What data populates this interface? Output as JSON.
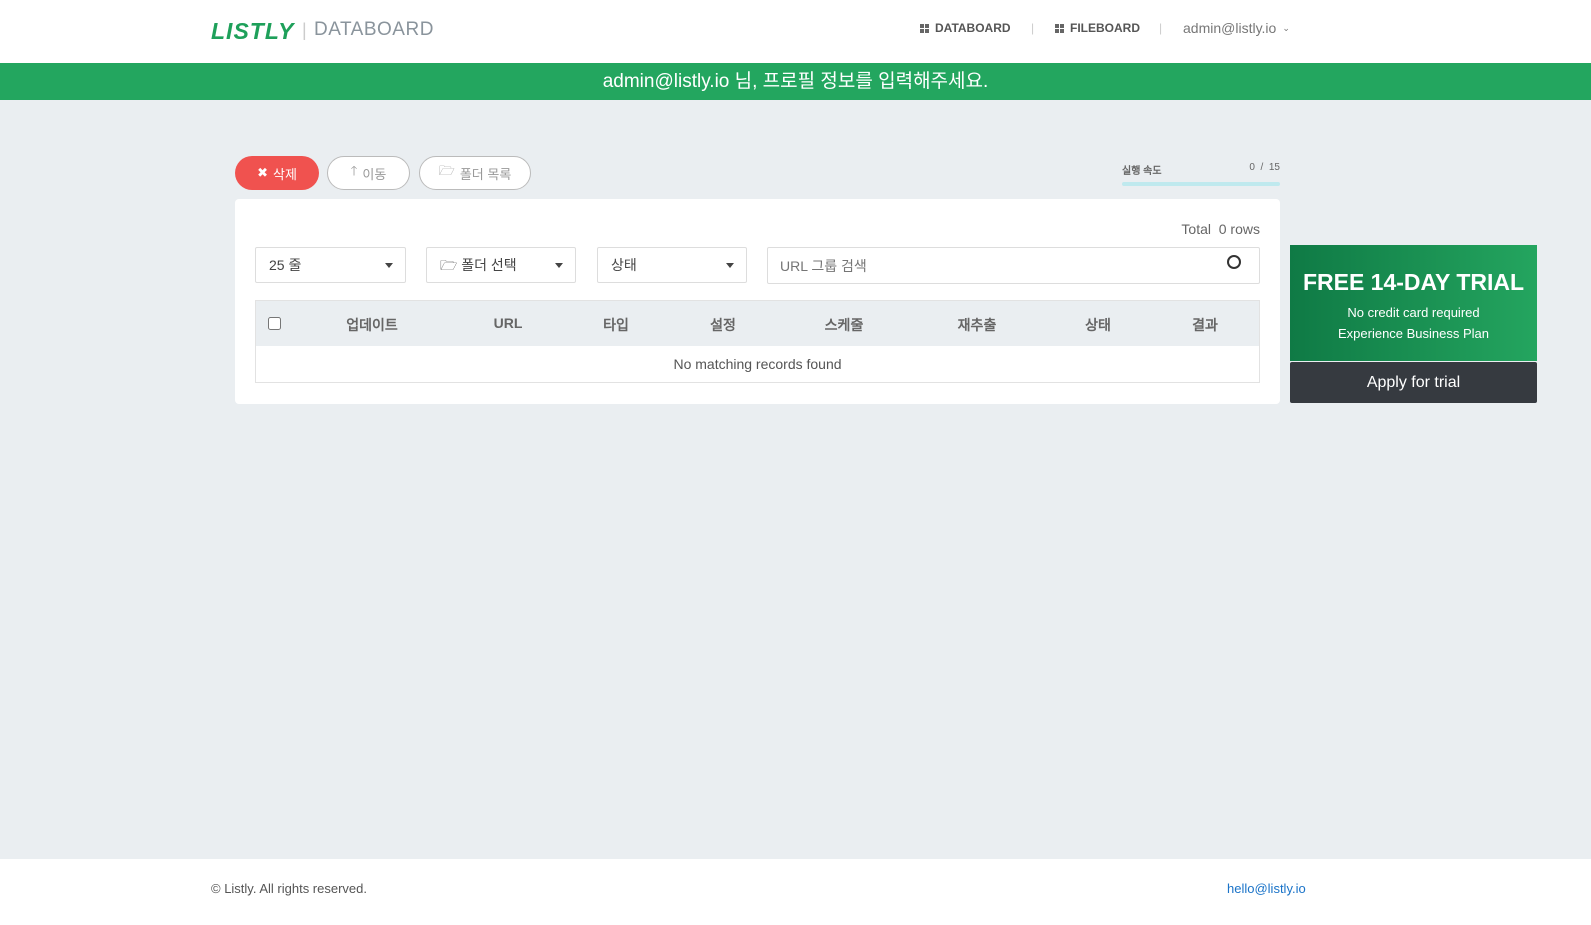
{
  "header": {
    "logo": "LISTLY",
    "product": "DATABOARD",
    "nav": [
      {
        "label": "DATABOARD"
      },
      {
        "label": "FILEBOARD"
      }
    ],
    "user": "admin@listly.io"
  },
  "banner": "admin@listly.io 님, 프로필 정보를 입력해주세요.",
  "toolbar": {
    "delete": "삭제",
    "move": "이동",
    "folders": "폴더 목록"
  },
  "speed": {
    "label": "실행 속도",
    "current": "0",
    "max": "15",
    "value": 0
  },
  "card": {
    "total": "Total  0 rows",
    "rows_select": "25 줄",
    "folder_select": "폴더 선택",
    "status_select": "상태",
    "search_placeholder": "URL 그룹 검색",
    "columns": [
      "업데이트",
      "URL",
      "타입",
      "설정",
      "스케줄",
      "재추출",
      "상태",
      "결과"
    ],
    "empty": "No matching records found"
  },
  "trial": {
    "title": "FREE 14-DAY TRIAL",
    "line1": "No credit card required",
    "line2": "Experience Business Plan",
    "button": "Apply for trial"
  },
  "footer": {
    "copyright": "© Listly. All rights reserved.",
    "email": "hello@listly.io"
  }
}
